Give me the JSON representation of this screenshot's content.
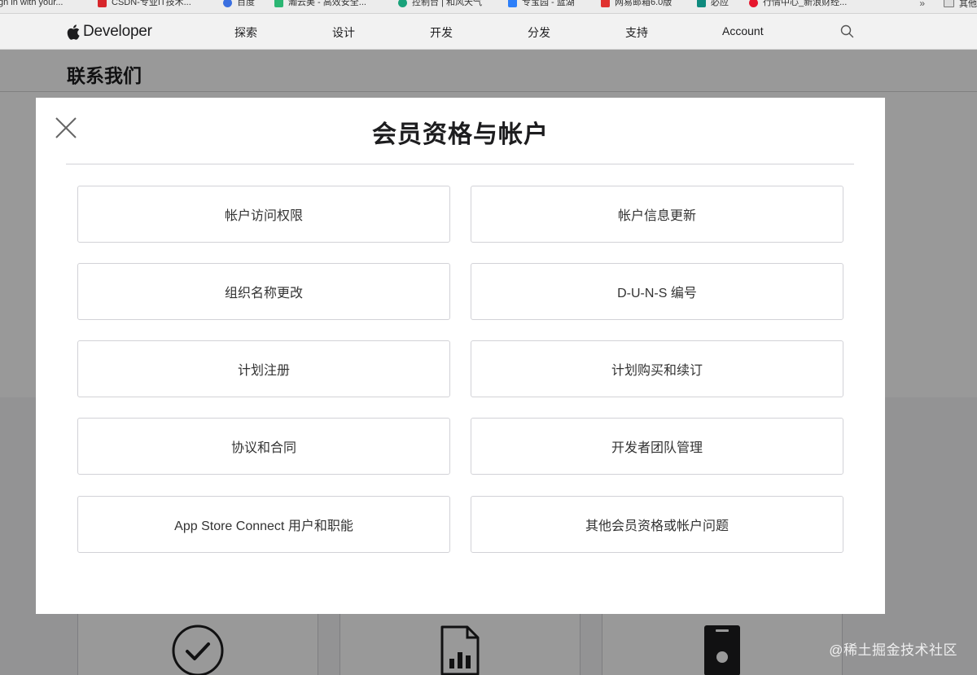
{
  "bookmarks_bar": {
    "items": [
      {
        "label": "gn in with your...",
        "icon": "none"
      },
      {
        "label": "CSDN-专业IT技术...",
        "icon": "csdn-icon"
      },
      {
        "label": "百度",
        "icon": "baidu-icon"
      },
      {
        "label": "瀚云美 - 高效安全...",
        "icon": "site-icon"
      },
      {
        "label": "控制台 | 和风天气",
        "icon": "site-icon"
      },
      {
        "label": "专宝园 - 蓝湖",
        "icon": "site-icon"
      },
      {
        "label": "网易邮箱6.0版",
        "icon": "mail-icon"
      },
      {
        "label": "必应",
        "icon": "bing-icon"
      },
      {
        "label": "行情中心_新浪财经...",
        "icon": "weibo-icon"
      }
    ],
    "more": "»",
    "folder_label": "其他"
  },
  "global_nav": {
    "brand": "Developer",
    "items": [
      "探索",
      "设计",
      "开发",
      "分发",
      "支持",
      "Account"
    ]
  },
  "page": {
    "title": "联系我们"
  },
  "modal": {
    "title": "会员资格与帐户",
    "options": [
      "帐户访问权限",
      "帐户信息更新",
      "组织名称更改",
      "D-U-N-S 编号",
      "计划注册",
      "计划购买和续订",
      "协议和合同",
      "开发者团队管理",
      "App Store Connect 用户和职能",
      "其他会员资格或帐户问题"
    ]
  },
  "watermark": "@稀土掘金技术社区",
  "colors": {
    "overlay": "rgba(0,0,0,0.40)",
    "nav_bg": "#f2f2f2",
    "border": "#d2d2d7",
    "text": "#1d1d1f"
  }
}
